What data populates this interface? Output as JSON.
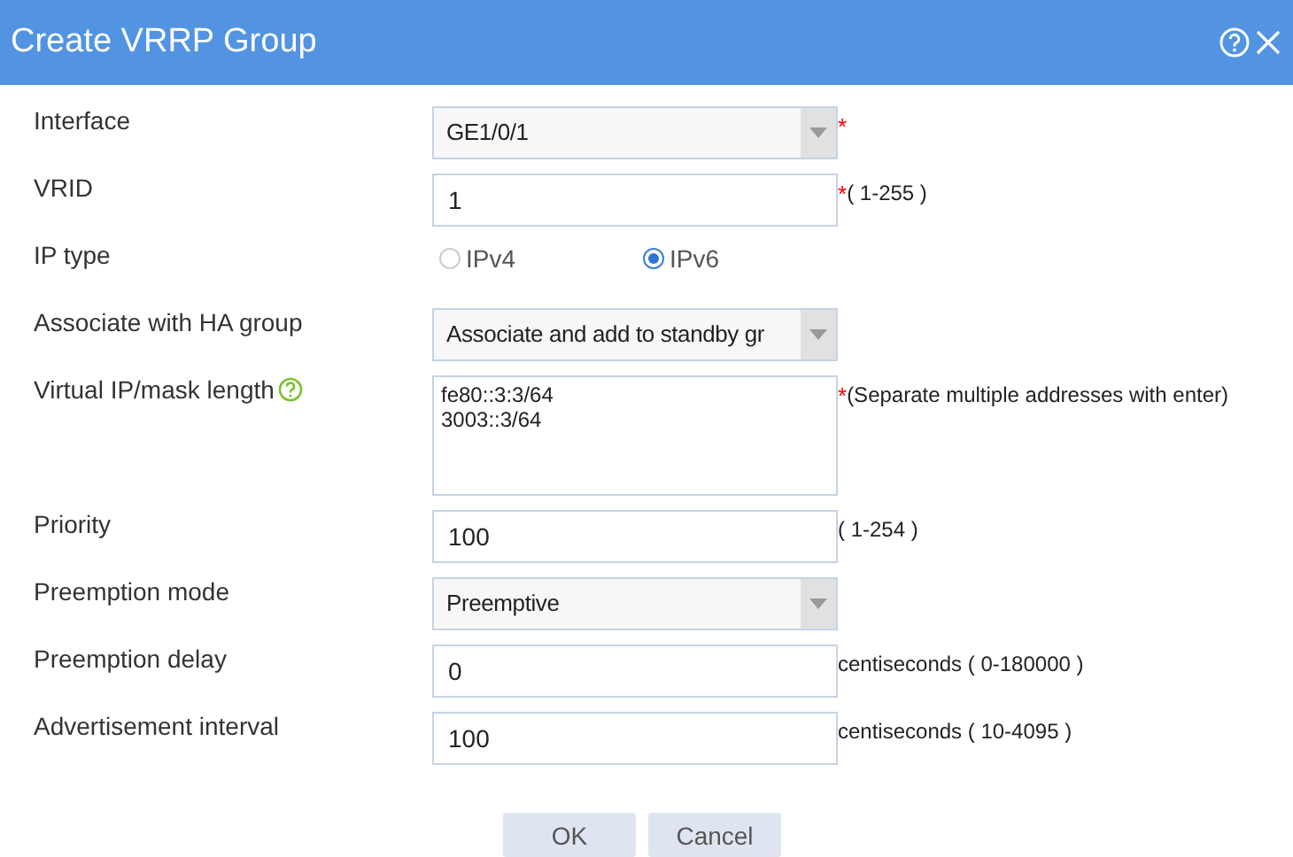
{
  "window": {
    "title": "Create VRRP Group"
  },
  "fields": [
    {
      "kind": "select",
      "label": "Interface",
      "value": "GE1/0/1",
      "required": "*"
    },
    {
      "kind": "input",
      "label": "VRID",
      "value": "1",
      "required": "*",
      "hint": "( 1-255 )"
    },
    {
      "kind": "radio",
      "label": "IP type",
      "options": [
        {
          "label": "IPv4",
          "selected": false
        },
        {
          "label": "IPv6",
          "selected": true
        }
      ]
    },
    {
      "kind": "select",
      "label": "Associate with HA group",
      "value": "Associate and add to standby gr"
    },
    {
      "kind": "textarea",
      "label": "Virtual IP/mask length",
      "help": true,
      "value": "fe80::3:3/64\n3003::3/64",
      "required": "*",
      "hint": "(Separate multiple addresses with enter)"
    },
    {
      "kind": "input",
      "label": "Priority",
      "value": "100",
      "hint": "( 1-254 )"
    },
    {
      "kind": "select",
      "label": "Preemption mode",
      "value": "Preemptive"
    },
    {
      "kind": "input",
      "label": "Preemption delay",
      "value": "0",
      "hint": "centiseconds ( 0-180000 )"
    },
    {
      "kind": "input",
      "label": "Advertisement interval",
      "value": "100",
      "hint": "centiseconds ( 10-4095 )"
    }
  ],
  "buttons": [
    "OK",
    "Cancel"
  ]
}
